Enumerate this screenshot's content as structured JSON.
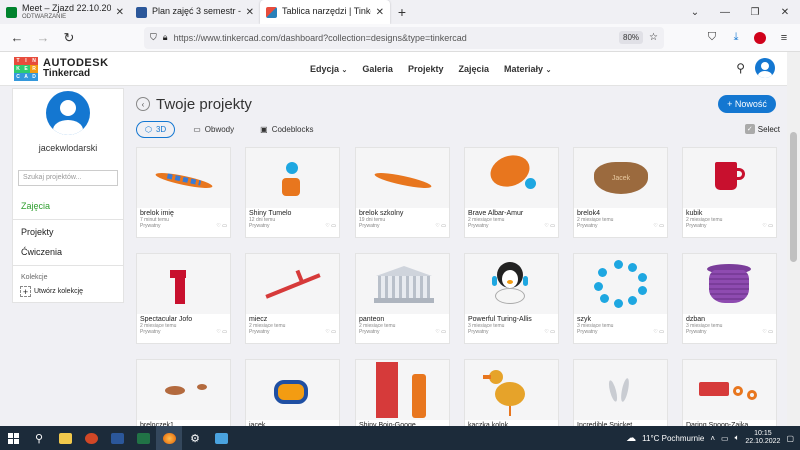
{
  "browser": {
    "tabs": [
      {
        "title": "Meet – Zjazd 22.10.2022",
        "subtitle": "ODTWARZANIE",
        "favicon_color": "#00832d",
        "active": false
      },
      {
        "title": "Plan zajęć 3 semestr - Poczta w",
        "favicon_color": "#2b579a",
        "active": false
      },
      {
        "title": "Tablica narzędzi | Tinkercad",
        "favicon_color": "#e74c3c",
        "active": true
      }
    ],
    "new_tab_label": "+",
    "url": "https://www.tinkercad.com/dashboard?collection=designs&type=tinkercad",
    "zoom": "80%"
  },
  "header": {
    "logo_letters": [
      "T",
      "I",
      "N",
      "K",
      "E",
      "R",
      "C",
      "A",
      "D"
    ],
    "brand_line1": "AUTODESK",
    "brand_line2": "Tinkercad",
    "nav": [
      "Edycja",
      "Galeria",
      "Projekty",
      "Zajęcia",
      "Materiały"
    ],
    "dropdown_items": [
      true,
      false,
      false,
      false,
      true
    ]
  },
  "sidebar": {
    "username": "jacekwlodarski",
    "search_placeholder": "Szukaj projektów...",
    "zajecia": "Zajęcia",
    "projekty": "Projekty",
    "cwiczenia": "Ćwiczenia",
    "collections_label": "Kolekcje",
    "create_collection": "Utwórz kolekcję"
  },
  "main": {
    "title": "Twoje projekty",
    "new_button": "+ Nowość",
    "filters": [
      "3D",
      "Obwody",
      "Codeblocks"
    ],
    "select_label": "Select"
  },
  "projects": [
    {
      "name": "brelok imię",
      "time": "7 minut temu",
      "privacy": "Prywatny"
    },
    {
      "name": "Shiny Tumelo",
      "time": "12 dni temu",
      "privacy": "Prywatny"
    },
    {
      "name": "brelok szkolny",
      "time": "19 dni temu",
      "privacy": "Prywatny"
    },
    {
      "name": "Brave Albar-Amur",
      "time": "2 miesiące temu",
      "privacy": "Prywatny"
    },
    {
      "name": "brelok4",
      "time": "2 miesiące temu",
      "privacy": "Prywatny"
    },
    {
      "name": "kubik",
      "time": "2 miesiące temu",
      "privacy": "Prywatny"
    },
    {
      "name": "Spectacular Jofo",
      "time": "2 miesiące temu",
      "privacy": "Prywatny"
    },
    {
      "name": "miecz",
      "time": "2 miesiące temu",
      "privacy": "Prywatny"
    },
    {
      "name": "panteon",
      "time": "2 miesiące temu",
      "privacy": "Prywatny"
    },
    {
      "name": "Powerful Turing-Allis",
      "time": "3 miesiące temu",
      "privacy": "Prywatny"
    },
    {
      "name": "szyk",
      "time": "3 miesiące temu",
      "privacy": "Prywatny"
    },
    {
      "name": "dzban",
      "time": "3 miesiące temu",
      "privacy": "Prywatny"
    },
    {
      "name": "breloczek1",
      "time": "",
      "privacy": ""
    },
    {
      "name": "jacek",
      "time": "",
      "privacy": ""
    },
    {
      "name": "Shiny Bojo-Googe",
      "time": "",
      "privacy": ""
    },
    {
      "name": "kaczka kolok",
      "time": "",
      "privacy": ""
    },
    {
      "name": "Incredible Snicket",
      "time": "",
      "privacy": ""
    },
    {
      "name": "Daring Snoop-Zaika",
      "time": "",
      "privacy": ""
    }
  ],
  "taskbar": {
    "weather": "11°C Pochmurnie",
    "time": "10:15",
    "date": "22.10.2022"
  },
  "colors": {
    "accent": "#1477d1",
    "orange": "#e8761e",
    "zajecia_green": "#2e9e2e"
  }
}
